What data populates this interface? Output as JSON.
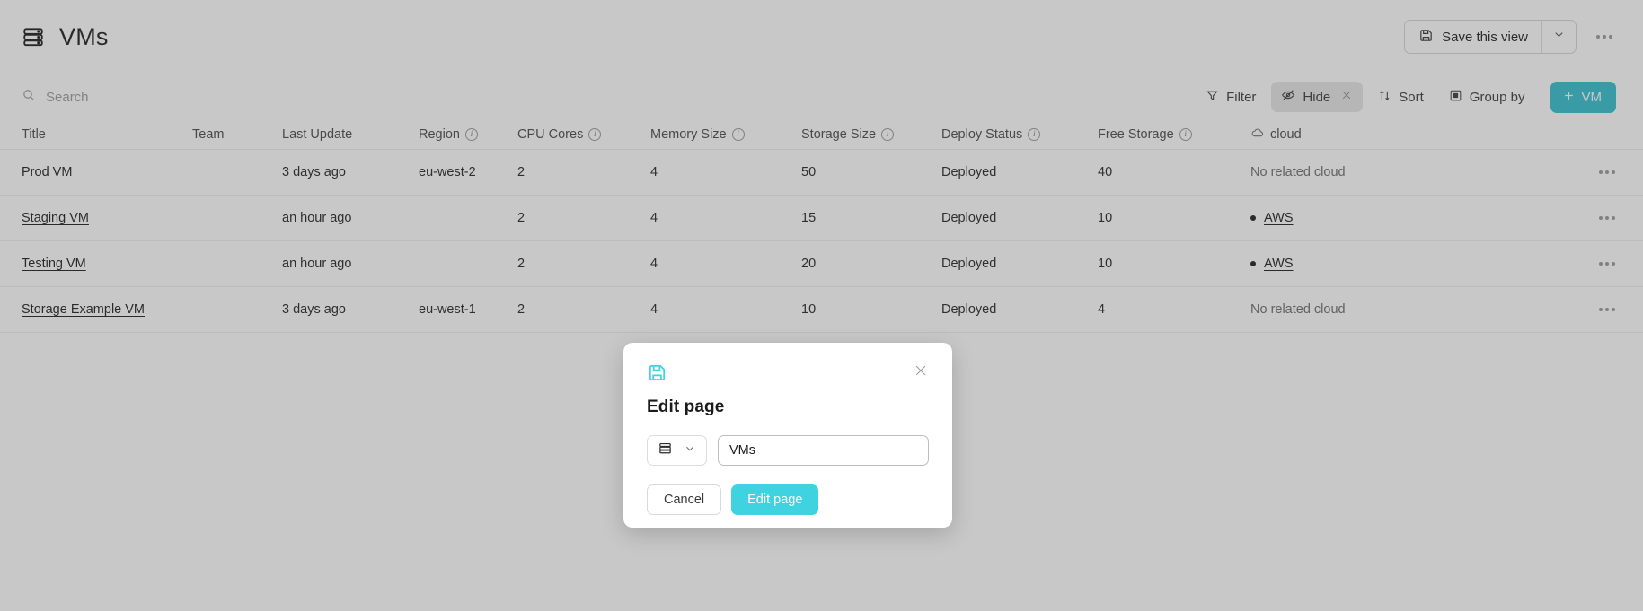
{
  "header": {
    "icon": "server-stack-icon",
    "title": "VMs",
    "save_view_label": "Save this view",
    "save_icon": "floppy-disk-icon",
    "caret_icon": "chevron-down-icon",
    "more_icon": "ellipsis-icon"
  },
  "search": {
    "placeholder": "Search",
    "value": "",
    "icon": "search-icon"
  },
  "toolbar": {
    "filter_label": "Filter",
    "hide_label": "Hide",
    "sort_label": "Sort",
    "group_by_label": "Group by",
    "add_label": "VM",
    "add_icon": "plus-icon",
    "filter_icon": "funnel-icon",
    "hide_icon": "eye-off-icon",
    "hide_clear_icon": "close-icon",
    "sort_icon": "sort-arrows-icon",
    "group_icon": "group-icon",
    "accent_color": "#31bfcf"
  },
  "table": {
    "columns": [
      {
        "label": "Title",
        "info": false
      },
      {
        "label": "Team",
        "info": false
      },
      {
        "label": "Last Update",
        "info": false
      },
      {
        "label": "Region",
        "info": true
      },
      {
        "label": "CPU Cores",
        "info": true
      },
      {
        "label": "Memory Size",
        "info": true
      },
      {
        "label": "Storage Size",
        "info": true
      },
      {
        "label": "Deploy Status",
        "info": true
      },
      {
        "label": "Free Storage",
        "info": true
      },
      {
        "label": "cloud",
        "info": false,
        "icon": "cloud-icon"
      }
    ],
    "rows": [
      {
        "title": "Prod VM",
        "team": "",
        "last_update": "3 days ago",
        "region": "eu-west-2",
        "cpu_cores": "2",
        "memory_size": "4",
        "storage_size": "50",
        "deploy_status": "Deployed",
        "free_storage": "40",
        "cloud": "No related cloud",
        "cloud_linked": false
      },
      {
        "title": "Staging VM",
        "team": "",
        "last_update": "an hour ago",
        "region": "",
        "cpu_cores": "2",
        "memory_size": "4",
        "storage_size": "15",
        "deploy_status": "Deployed",
        "free_storage": "10",
        "cloud": "AWS",
        "cloud_linked": true
      },
      {
        "title": "Testing VM",
        "team": "",
        "last_update": "an hour ago",
        "region": "",
        "cpu_cores": "2",
        "memory_size": "4",
        "storage_size": "20",
        "deploy_status": "Deployed",
        "free_storage": "10",
        "cloud": "AWS",
        "cloud_linked": true
      },
      {
        "title": "Storage Example VM",
        "team": "",
        "last_update": "3 days ago",
        "region": "eu-west-1",
        "cpu_cores": "2",
        "memory_size": "4",
        "storage_size": "10",
        "deploy_status": "Deployed",
        "free_storage": "4",
        "cloud": "No related cloud",
        "cloud_linked": false
      }
    ],
    "row_action_icon": "ellipsis-icon"
  },
  "modal": {
    "icon": "floppy-disk-icon",
    "icon_color": "#3fd2e0",
    "close_icon": "close-icon",
    "title": "Edit page",
    "page_icon": "server-stack-icon",
    "page_icon_caret": "chevron-down-icon",
    "name_value": "VMs",
    "name_placeholder": "Page name",
    "cancel_label": "Cancel",
    "submit_label": "Edit page",
    "submit_color": "#3fd2e0"
  }
}
